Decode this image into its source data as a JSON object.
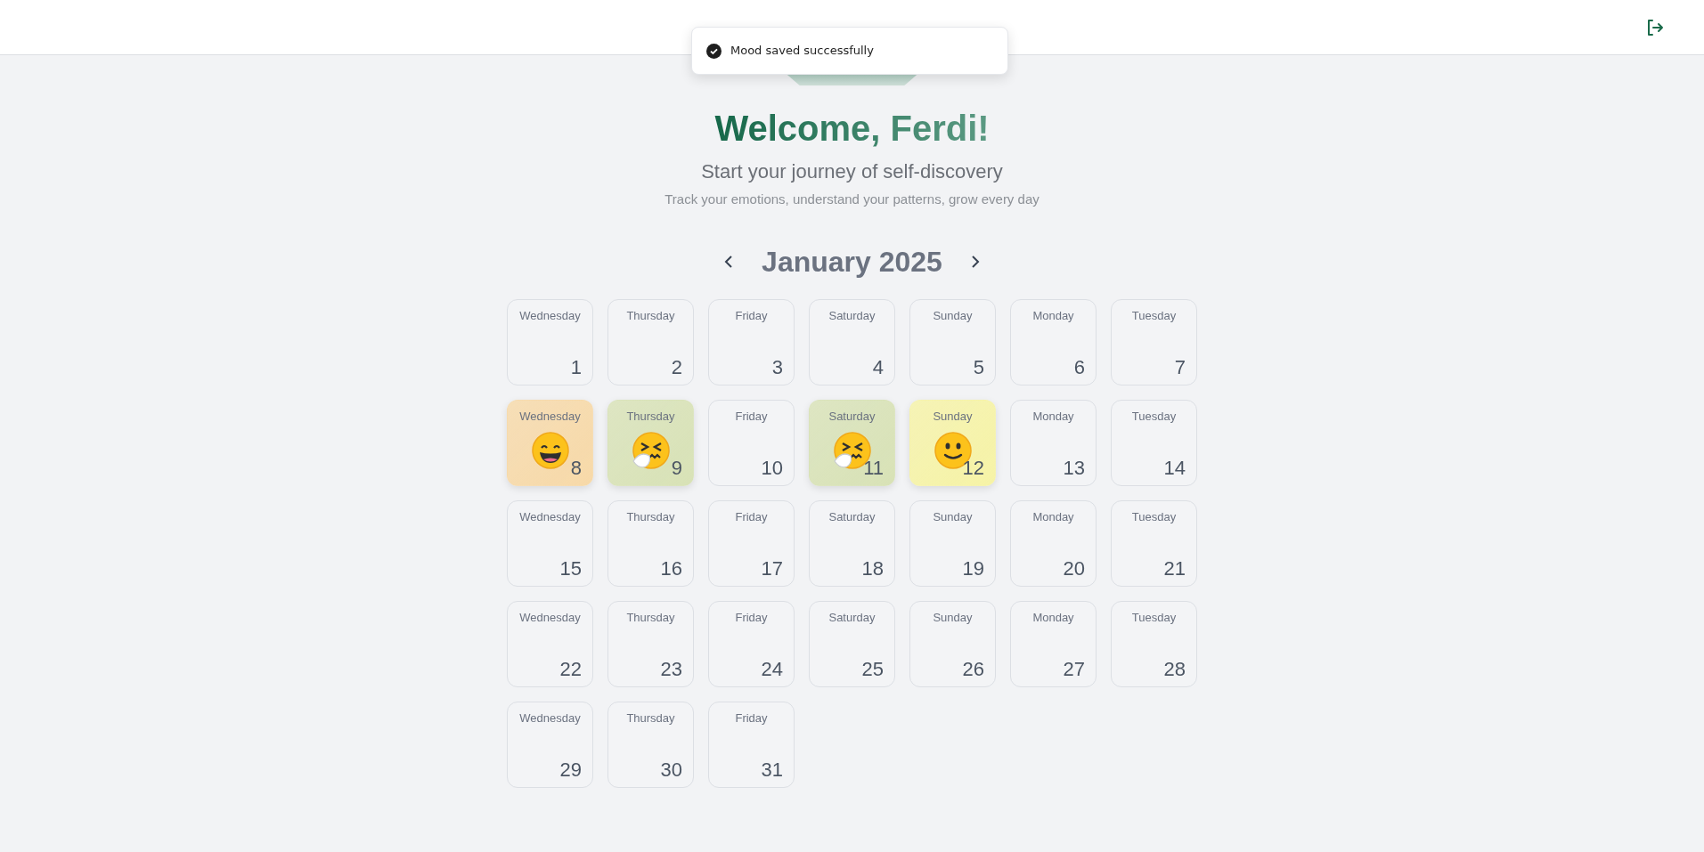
{
  "toast": {
    "message": "Mood saved successfully"
  },
  "hero": {
    "title": "Welcome, Ferdi!",
    "subtitle": "Start your journey of self-discovery",
    "caption": "Track your emotions, understand your patterns, grow every day"
  },
  "calendar": {
    "month": "January 2025",
    "days": [
      {
        "weekday": "Wednesday",
        "day": "1"
      },
      {
        "weekday": "Thursday",
        "day": "2"
      },
      {
        "weekday": "Friday",
        "day": "3"
      },
      {
        "weekday": "Saturday",
        "day": "4"
      },
      {
        "weekday": "Sunday",
        "day": "5"
      },
      {
        "weekday": "Monday",
        "day": "6"
      },
      {
        "weekday": "Tuesday",
        "day": "7"
      },
      {
        "weekday": "Wednesday",
        "day": "8",
        "kind": "grinning",
        "color": "#f7d9a8"
      },
      {
        "weekday": "Thursday",
        "day": "9",
        "kind": "sneezing",
        "color": "#d8e2b6"
      },
      {
        "weekday": "Friday",
        "day": "10"
      },
      {
        "weekday": "Saturday",
        "day": "11",
        "kind": "sneezing",
        "color": "#d8e2b6"
      },
      {
        "weekday": "Sunday",
        "day": "12",
        "kind": "smiling",
        "color": "#f6f3a6"
      },
      {
        "weekday": "Monday",
        "day": "13"
      },
      {
        "weekday": "Tuesday",
        "day": "14"
      },
      {
        "weekday": "Wednesday",
        "day": "15"
      },
      {
        "weekday": "Thursday",
        "day": "16"
      },
      {
        "weekday": "Friday",
        "day": "17"
      },
      {
        "weekday": "Saturday",
        "day": "18"
      },
      {
        "weekday": "Sunday",
        "day": "19"
      },
      {
        "weekday": "Monday",
        "day": "20"
      },
      {
        "weekday": "Tuesday",
        "day": "21"
      },
      {
        "weekday": "Wednesday",
        "day": "22"
      },
      {
        "weekday": "Thursday",
        "day": "23"
      },
      {
        "weekday": "Friday",
        "day": "24"
      },
      {
        "weekday": "Saturday",
        "day": "25"
      },
      {
        "weekday": "Sunday",
        "day": "26"
      },
      {
        "weekday": "Monday",
        "day": "27"
      },
      {
        "weekday": "Tuesday",
        "day": "28"
      },
      {
        "weekday": "Wednesday",
        "day": "29"
      },
      {
        "weekday": "Thursday",
        "day": "30"
      },
      {
        "weekday": "Friday",
        "day": "31"
      }
    ]
  }
}
